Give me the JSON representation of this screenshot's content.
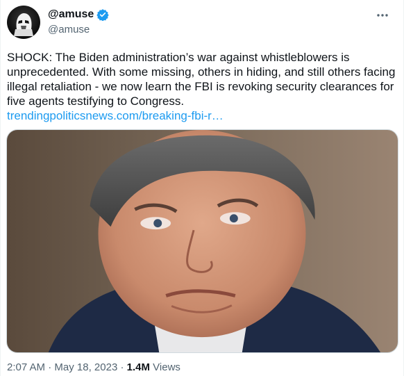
{
  "author": {
    "display_name": "@amuse",
    "handle": "@amuse",
    "verified": true,
    "avatar_icon": "stormtrooper-avatar-icon"
  },
  "tweet": {
    "text": "SHOCK: The Biden administration’s war against whistleblowers is unprecedented. With some missing, others in hiding, and still others facing illegal retaliation - we now learn the FBI is revoking security clearances for five agents testifying to Congress.",
    "link": "trendingpoliticsnews.com/breaking-fbi-r…"
  },
  "media": {
    "description_icon": "photo"
  },
  "meta": {
    "time": "2:07 AM",
    "separator": "·",
    "date": "May 18, 2023",
    "separator2": "·",
    "views_count": "1.4M",
    "views_label": "Views"
  },
  "colors": {
    "link": "#1d9bf0",
    "secondary_text": "#536471",
    "verified": "#1d9bf0"
  },
  "more_icon": "more-options-icon"
}
